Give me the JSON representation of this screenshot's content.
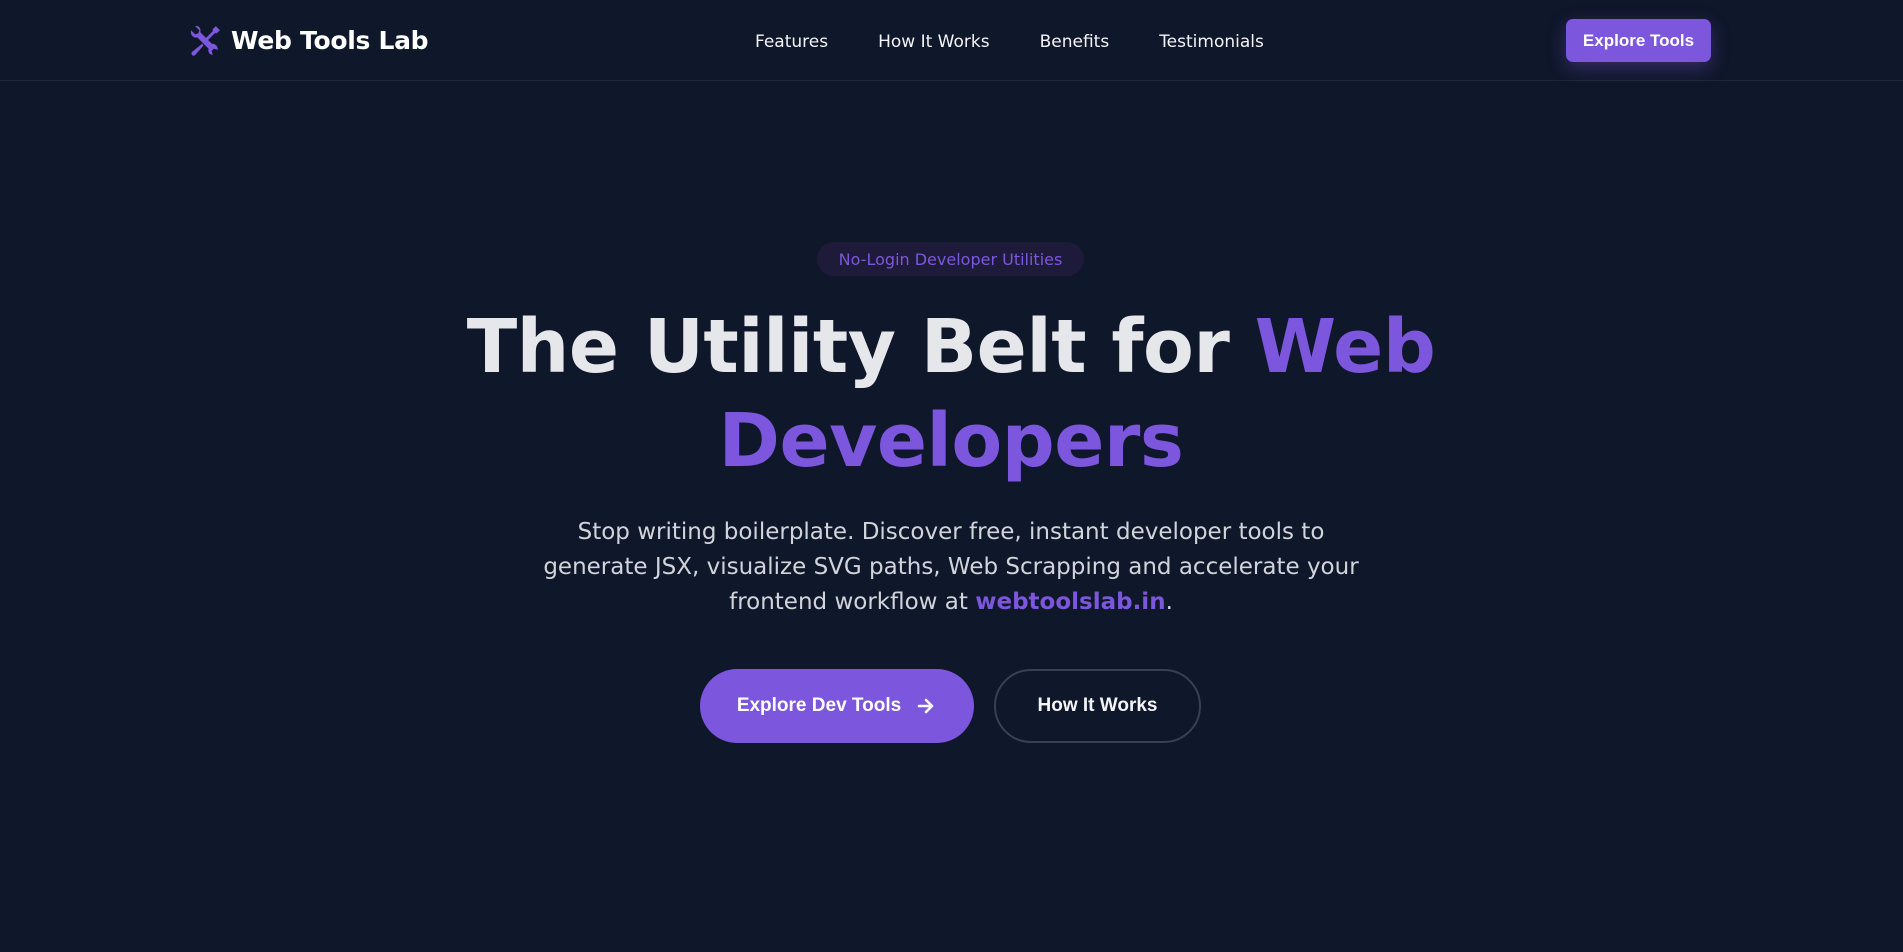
{
  "header": {
    "brand_name": "Web Tools Lab",
    "brand_icon": "tools-icon",
    "nav": [
      {
        "label": "Features"
      },
      {
        "label": "How It Works"
      },
      {
        "label": "Benefits"
      },
      {
        "label": "Testimonials"
      }
    ],
    "cta_label": "Explore Tools"
  },
  "hero": {
    "badge": "No-Login Developer Utilities",
    "headline_plain": "The Utility Belt for ",
    "headline_accent": "Web Developers",
    "subtitle_text": "Stop writing boilerplate. Discover free, instant developer tools to generate JSX, visualize SVG paths, Web Scrapping and accelerate your frontend workflow at ",
    "subtitle_link": "webtoolslab.in",
    "subtitle_end": ".",
    "primary_button": "Explore Dev Tools",
    "primary_button_icon": "arrow-right-icon",
    "secondary_button": "How It Works"
  },
  "colors": {
    "background": "#0f172a",
    "accent": "#7c56dc",
    "text": "#e5e7eb"
  }
}
